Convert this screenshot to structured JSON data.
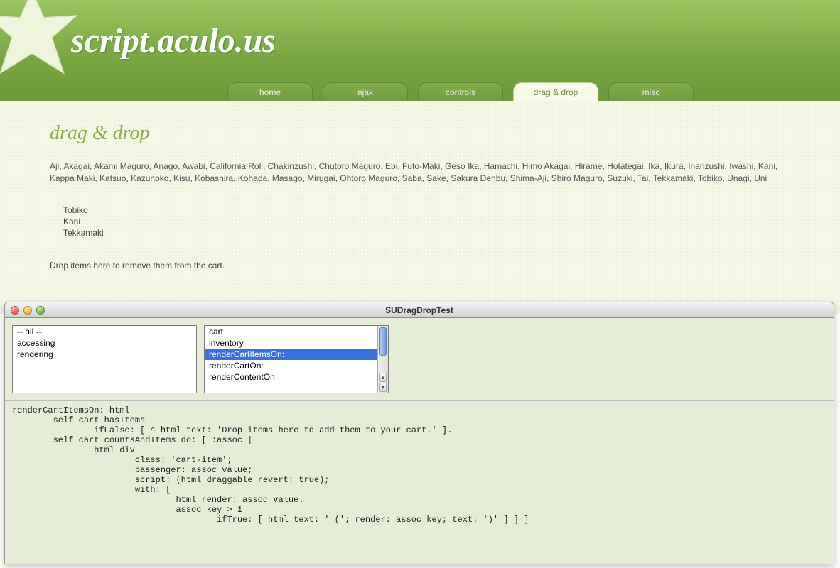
{
  "site": {
    "title": "script.aculo.us"
  },
  "nav": {
    "tabs": [
      {
        "label": "home",
        "active": false
      },
      {
        "label": "ajax",
        "active": false
      },
      {
        "label": "controls",
        "active": false
      },
      {
        "label": "drag & drop",
        "active": true
      },
      {
        "label": "misc",
        "active": false
      }
    ]
  },
  "page": {
    "heading": "drag & drop",
    "inventory": "Aji, Akagai, Akami Maguro, Anago, Awabi, California Roll, Chakinzushi, Chutoro Maguro, Ebi, Futo-Maki, Geso Ika, Hamachi, Himo Akagai, Hirame, Hotategai, Ika, Ikura, Inarizushi, Iwashi, Kani, Kappa Maki, Katsuo, Kazunoko, Kisu, Kobashira, Kohada, Masago, Mirugai, Ohtoro Maguro, Saba, Sake, Sakura Denbu, Shima-Aji, Shiro Maguro, Suzuki, Tai, Tekkamaki, Tobiko, Unagi, Uni",
    "cart_items": [
      "Tobiko",
      "Kani",
      "Tekkamaki"
    ],
    "drop_hint": "Drop items here to remove them from the cart."
  },
  "browser": {
    "window_title": "SUDragDropTest",
    "protocol_list": [
      "-- all --",
      "accessing",
      "rendering"
    ],
    "method_list": [
      "cart",
      "inventory",
      "renderCartItemsOn:",
      "renderCartOn:",
      "renderContentOn:"
    ],
    "selected_method_index": 2,
    "code": "renderCartItemsOn: html\n        self cart hasItems\n                ifFalse: [ ^ html text: 'Drop items here to add them to your cart.' ].\n        self cart countsAndItems do: [ :assoc |\n                html div\n                        class: 'cart-item';\n                        passenger: assoc value;\n                        script: (html draggable revert: true);\n                        with: [\n                                html render: assoc value.\n                                assoc key > 1\n                                        ifTrue: [ html text: ' ('; render: assoc key; text: ')' ] ] ]"
  }
}
